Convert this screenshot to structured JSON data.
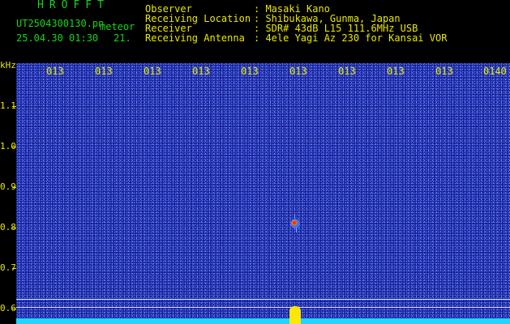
{
  "header": {
    "app_title": "HROFFT",
    "filename": "UT2504300130.pn",
    "tag": "meteor",
    "timestamp": "25.04.30 01:30",
    "count": "21.",
    "fields": [
      {
        "label": "Observer",
        "value": ": Masaki Kano"
      },
      {
        "label": "Receiving Location",
        "value": ": Shibukawa, Gunma, Japan"
      },
      {
        "label": "Receiver",
        "value": ": SDR# 43dB L15 111.6MHz USB"
      },
      {
        "label": "Receiving Antenna",
        "value": ": 4ele Yagi Az 230 for Kansai VOR"
      }
    ]
  },
  "y_axis": {
    "unit": "kHz",
    "labels": [
      "1.1",
      "1.0",
      "0.9",
      "0.8",
      "0.7",
      "0.6"
    ]
  },
  "x_axis": {
    "labels": [
      "013",
      "013",
      "013",
      "013",
      "013",
      "013",
      "013",
      "013",
      "013",
      "0140"
    ]
  },
  "colors": {
    "background": "#1a2aa6",
    "signal": "#ffe800",
    "noise_floor": "#1ed6ff"
  }
}
